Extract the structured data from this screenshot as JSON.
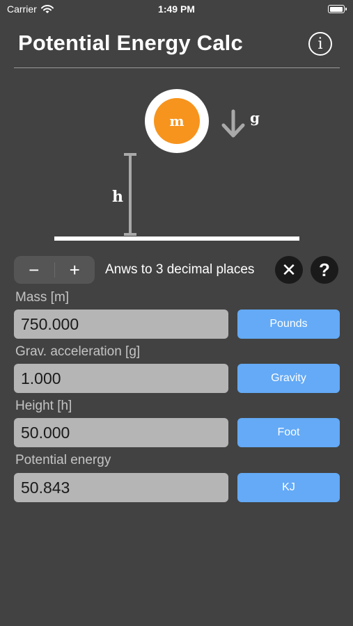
{
  "status_bar": {
    "carrier": "Carrier",
    "time": "1:49 PM",
    "battery_level": 1.0
  },
  "header": {
    "title": "Potential Energy Calc",
    "info_icon": "info-circle-icon"
  },
  "diagram": {
    "mass_symbol": "m",
    "gravity_symbol": "g",
    "height_symbol": "h",
    "ball_color": "#f7941d"
  },
  "precision": {
    "label": "Anws to 3 decimal places",
    "minus": "−",
    "plus": "+",
    "clear": "✕",
    "help": "?"
  },
  "fields": [
    {
      "label": "Mass [m]",
      "value": "750.000",
      "unit": "Pounds"
    },
    {
      "label": "Grav. acceleration [g]",
      "value": "1.000",
      "unit": "Gravity"
    },
    {
      "label": "Height [h]",
      "value": "50.000",
      "unit": "Foot"
    },
    {
      "label": "Potential energy",
      "value": "50.843",
      "unit": "KJ"
    }
  ],
  "colors": {
    "background": "#424242",
    "unit_button": "#64aaf6",
    "field_background": "#b5b5b5",
    "accent": "#f7941d"
  }
}
